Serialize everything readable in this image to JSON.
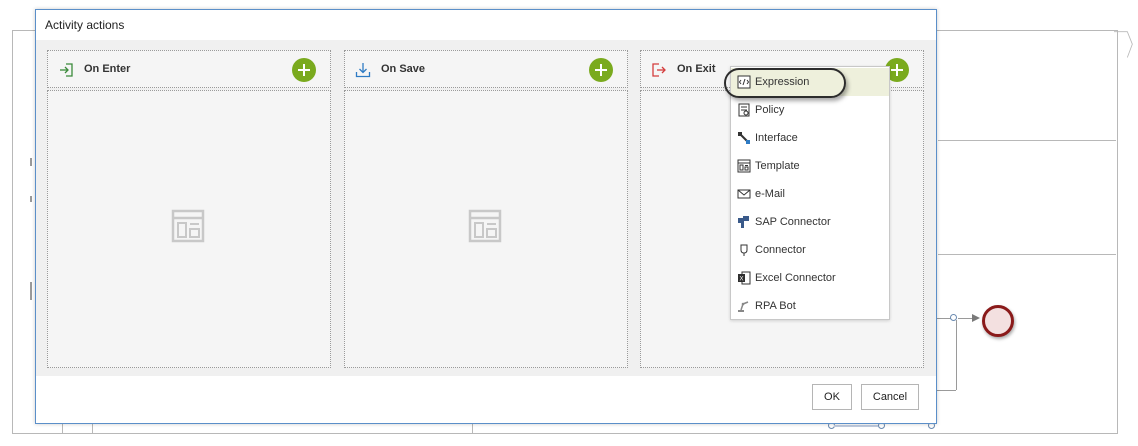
{
  "dialog": {
    "title": "Activity actions",
    "panels": [
      {
        "label": "On Enter",
        "icon": "enter-icon",
        "color": "#3a8a3a"
      },
      {
        "label": "On Save",
        "icon": "save-icon",
        "color": "#2e7bc4"
      },
      {
        "label": "On Exit",
        "icon": "exit-icon",
        "color": "#d43c3c"
      }
    ],
    "ok_label": "OK",
    "cancel_label": "Cancel"
  },
  "menu": {
    "items": [
      {
        "label": "Expression",
        "icon": "expression-icon",
        "active": true
      },
      {
        "label": "Policy",
        "icon": "policy-icon"
      },
      {
        "label": "Interface",
        "icon": "interface-icon"
      },
      {
        "label": "Template",
        "icon": "template-icon"
      },
      {
        "label": "e-Mail",
        "icon": "email-icon"
      },
      {
        "label": "SAP Connector",
        "icon": "sap-connector-icon"
      },
      {
        "label": "Connector",
        "icon": "connector-icon"
      },
      {
        "label": "Excel Connector",
        "icon": "excel-connector-icon"
      },
      {
        "label": "RPA Bot",
        "icon": "rpa-bot-icon"
      }
    ]
  },
  "colors": {
    "accent": "#7aaa1e",
    "dialog_border": "#5b8fc9",
    "end_event": "#8a1a1a"
  }
}
